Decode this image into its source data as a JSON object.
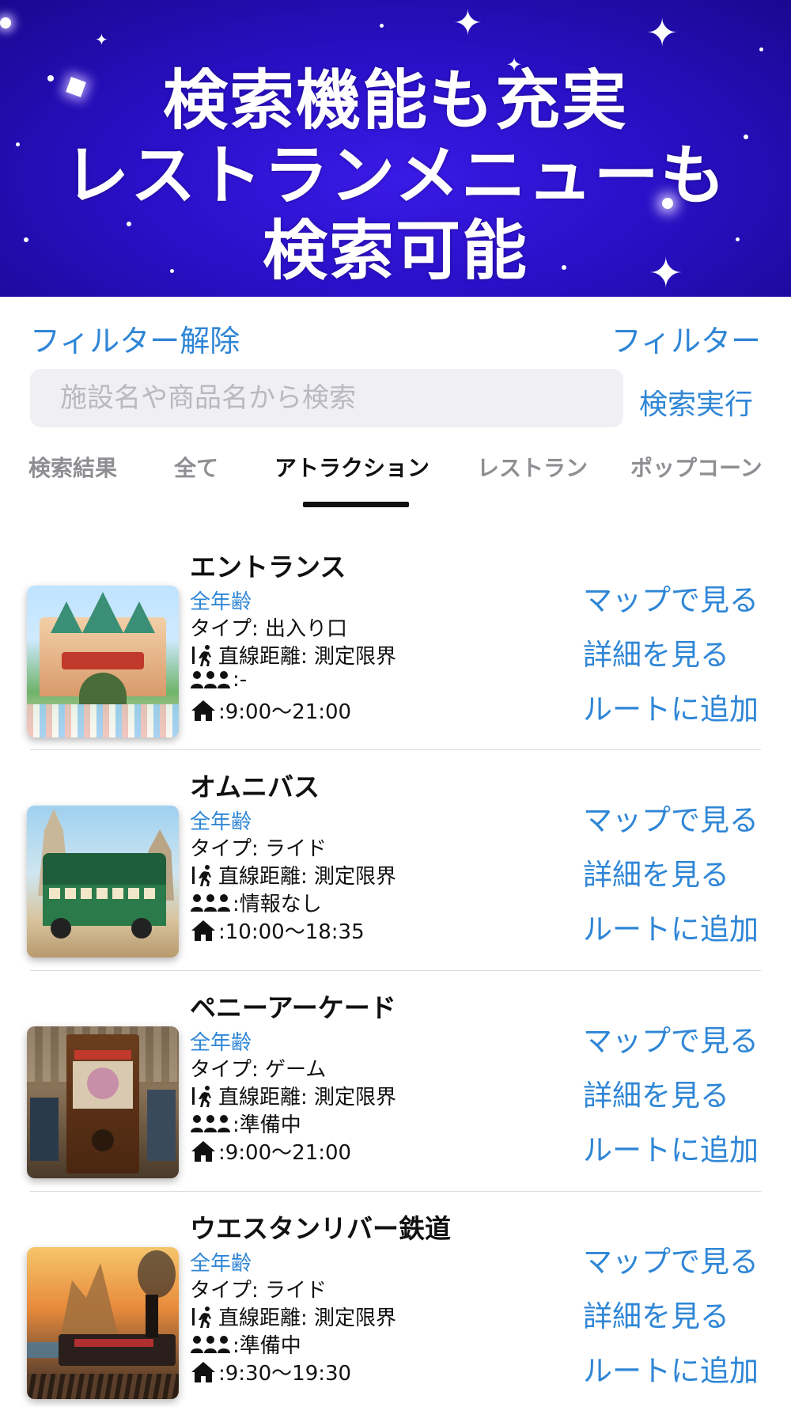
{
  "hero": {
    "line1": "検索機能も充実",
    "line2": "レストランメニューも",
    "line3": "検索可能"
  },
  "toolbar": {
    "filter_clear": "フィルター解除",
    "filter": "フィルター",
    "search_placeholder": "施設名や商品名から検索",
    "search_exec": "検索実行"
  },
  "tabs": [
    {
      "label": "検索結果"
    },
    {
      "label": "全て"
    },
    {
      "label": "アトラクション",
      "active": true
    },
    {
      "label": "レストラン"
    },
    {
      "label": "ポップコーン"
    }
  ],
  "actions": {
    "map": "マップで見る",
    "detail": "詳細を見る",
    "route": "ルートに追加"
  },
  "items": [
    {
      "title": "エントランス",
      "age": "全年齢",
      "type": "タイプ: 出入り口",
      "distance": "直線距離: 測定限界",
      "crowd": ":-",
      "hours": ":9:00～21:00"
    },
    {
      "title": "オムニバス",
      "age": "全年齢",
      "type": "タイプ: ライド",
      "distance": "直線距離: 測定限界",
      "crowd": ":情報なし",
      "hours": ":10:00～18:35"
    },
    {
      "title": "ペニーアーケード",
      "age": "全年齢",
      "type": "タイプ: ゲーム",
      "distance": "直線距離: 測定限界",
      "crowd": ":準備中",
      "hours": ":9:00～21:00"
    },
    {
      "title": "ウエスタンリバー鉄道",
      "age": "全年齢",
      "type": "タイプ: ライド",
      "distance": "直線距離: 測定限界",
      "crowd": ":準備中",
      "hours": ":9:30～19:30"
    }
  ],
  "colors": {
    "accent": "#2f86d6",
    "hero_bg": "#2a10c8"
  }
}
